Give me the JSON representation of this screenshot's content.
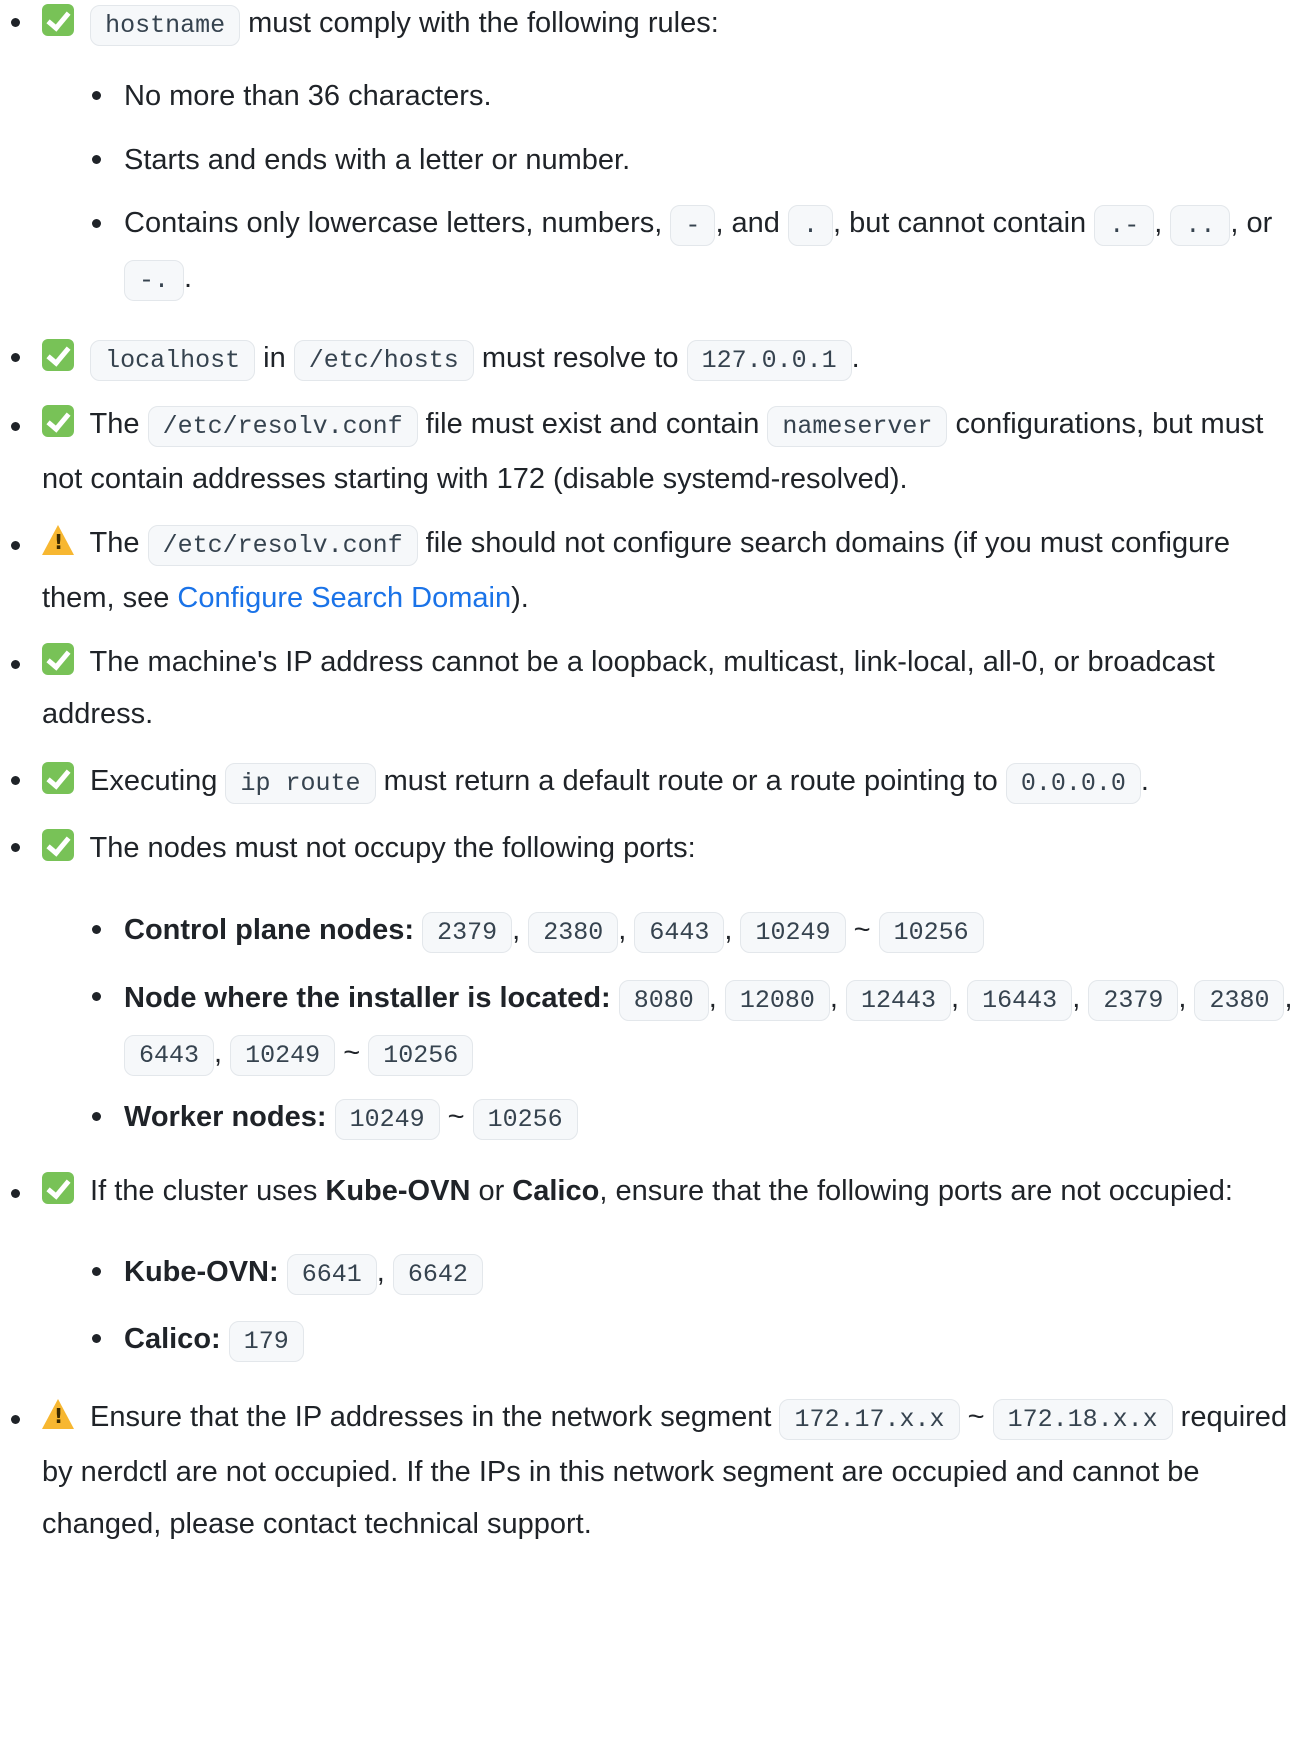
{
  "rules": {
    "hostname": {
      "code": "hostname",
      "text": " must comply with the following rules:",
      "sub": {
        "max_chars": "No more than 36 characters.",
        "starts_ends": "Starts and ends with a letter or number.",
        "contains_prefix": "Contains only lowercase letters, numbers, ",
        "code_dash": "-",
        "and": ", and ",
        "code_dot": ".",
        "cannot": ", but cannot contain ",
        "code_dot_dash": ".-",
        "comma": ", ",
        "code_dot_dot": "..",
        "comma_or": ",",
        "or": "or ",
        "code_dash_dot": "-.",
        "period": "."
      }
    },
    "localhost": {
      "code_localhost": "localhost",
      "in": " in ",
      "code_hosts": "/etc/hosts",
      "resolve": " must resolve to ",
      "code_ip": "127.0.0.1",
      "period": "."
    },
    "resolv": {
      "the": " The ",
      "code_file": "/etc/resolv.conf",
      "exist": " file must exist and contain ",
      "code_ns": "nameserver",
      "rest": " configurations, but must not contain addresses starting with 172 (disable systemd-resolved)."
    },
    "search": {
      "the": " The ",
      "code_file": "/etc/resolv.conf",
      "text": " file should not configure search domains (if you must configure them, see ",
      "link": "Configure Search Domain",
      "close": ")."
    },
    "ip_address": {
      "text": " The machine's IP address cannot be a loopback, multicast, link-local, all-0, or broadcast address."
    },
    "route": {
      "exec": " Executing ",
      "code_cmd": "ip route",
      "text": " must return a default route or a route pointing to ",
      "code_ip": "0.0.0.0",
      "period": "."
    },
    "ports": {
      "text": " The nodes must not occupy the following ports:",
      "control_label": "Control plane nodes:",
      "control": [
        "2379",
        "2380",
        "6443",
        "10249",
        "10256"
      ],
      "installer_label": "Node where the installer is located:",
      "installer": [
        "8080",
        "12080",
        "12443",
        "16443",
        "2379",
        "2380",
        "6443",
        "10249",
        "10256"
      ],
      "worker_label": "Worker nodes:",
      "worker": [
        "10249",
        "10256"
      ],
      "comma": ",",
      "tilde": "~"
    },
    "cni": {
      "pre": " If the cluster uses ",
      "kube_ovn": "Kube-OVN",
      "or": " or ",
      "calico": "Calico",
      "post": ", ensure that the following ports are not occupied:",
      "kube_label": "Kube-OVN:",
      "kube_ports": [
        "6641",
        "6642"
      ],
      "calico_label": "Calico:",
      "calico_ports": [
        "179"
      ]
    },
    "nerdctl": {
      "pre": " Ensure that the IP addresses in the network segment ",
      "code_a": "172.17.x.x",
      "tilde": "~",
      "code_b": "172.18.x.x",
      "post": " required by nerdctl are not occupied. If the IPs in this network segment are occupied and cannot be changed, please contact technical support."
    }
  },
  "icons": {
    "check": "check-icon",
    "warning": "warning-icon"
  },
  "colors": {
    "text": "#1f2328",
    "code_bg": "#f6f8fa",
    "link": "#1a73e8",
    "check": "#78c257",
    "warning": "#f7b731"
  }
}
